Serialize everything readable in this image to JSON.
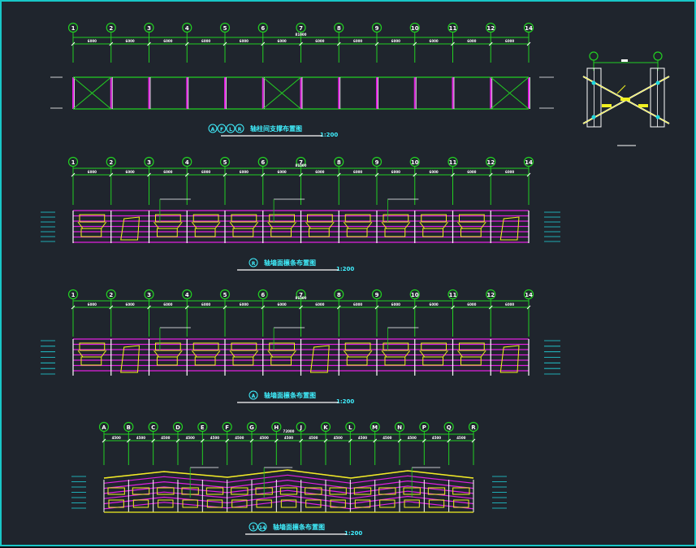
{
  "colors": {
    "background": "#1f252d",
    "border": "#18c7c7",
    "grid": "#22d022",
    "white": "#ffffff",
    "magenta": "#e020e0",
    "yellow": "#f0f020",
    "cyan": "#20d8e0",
    "title_text": "#40f0ff"
  },
  "rows": {
    "row1": {
      "labels": [
        "1",
        "2",
        "3",
        "4",
        "5",
        "6",
        "7",
        "8",
        "9",
        "10",
        "11",
        "12",
        "14"
      ],
      "total": "81000",
      "dims": [
        "6000",
        "6000",
        "6000",
        "6000",
        "6000",
        "6000",
        "6000",
        "6000",
        "6000",
        "6000",
        "6000",
        "6000"
      ],
      "title_text": "轴柱间支撑布置图",
      "title_axes": [
        "A",
        "F",
        "L",
        "R"
      ],
      "scale": "1:200"
    },
    "row2": {
      "labels": [
        "1",
        "2",
        "3",
        "4",
        "5",
        "6",
        "7",
        "8",
        "9",
        "10",
        "11",
        "12",
        "14"
      ],
      "total": "81000",
      "dims": [
        "6000",
        "6000",
        "6000",
        "6000",
        "6000",
        "6000",
        "6000",
        "6000",
        "6000",
        "6000",
        "6000",
        "6000"
      ],
      "title_text": "轴墙面檩条布置图",
      "title_axes": [
        "R"
      ],
      "scale": "1:200"
    },
    "row3": {
      "labels": [
        "1",
        "2",
        "3",
        "4",
        "5",
        "6",
        "7",
        "8",
        "9",
        "10",
        "11",
        "12",
        "14"
      ],
      "total": "81000",
      "dims": [
        "6000",
        "6000",
        "6000",
        "6000",
        "6000",
        "6000",
        "6000",
        "6000",
        "6000",
        "6000",
        "6000",
        "6000"
      ],
      "title_text": "轴墙面檩条布置图",
      "title_axes": [
        "A"
      ],
      "scale": "1:200"
    },
    "row4": {
      "labels": [
        "A",
        "B",
        "C",
        "D",
        "E",
        "F",
        "G",
        "H",
        "J",
        "K",
        "L",
        "M",
        "N",
        "P",
        "Q",
        "R"
      ],
      "total": "72000",
      "dims": [
        "4500",
        "4500",
        "4500",
        "4500",
        "4500",
        "4500",
        "4500",
        "4500",
        "4500",
        "4500",
        "4500",
        "4500",
        "4500",
        "4500",
        "4500"
      ],
      "title_text": "轴墙面檩条布置图",
      "title_axes": [
        "1",
        "14"
      ],
      "scale": "1:200"
    }
  },
  "detail": {
    "label": "100"
  }
}
